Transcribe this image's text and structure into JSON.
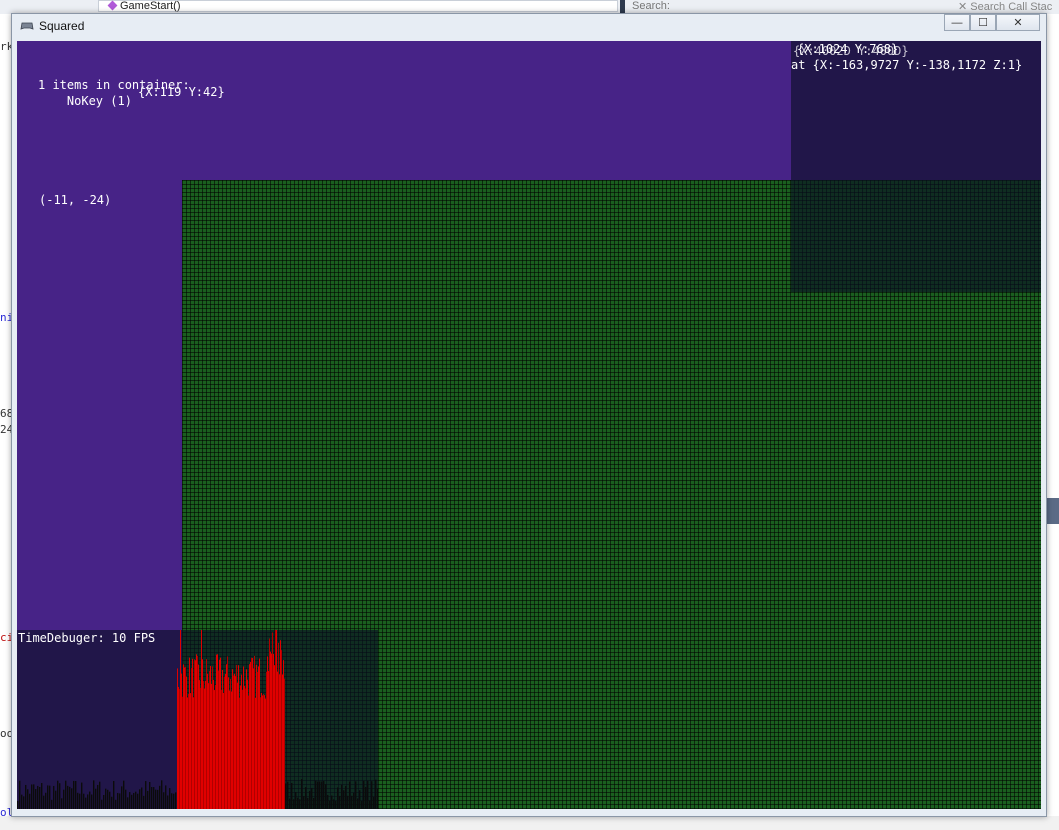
{
  "ide": {
    "dropdown_text": "GameStart()",
    "search_label": "Search:",
    "call_stack_search": "Search Call Stac",
    "left_fragments": [
      "rk",
      "ni",
      "68",
      "24",
      "oo",
      "ci",
      "ol"
    ]
  },
  "window": {
    "title": "Squared",
    "minimize_glyph": "—",
    "maximize_glyph": "☐",
    "close_glyph": "✕"
  },
  "game": {
    "container_info": "1 items in container:\n    NoKey (1)",
    "mouse_coords": "{X:119 Y:42}",
    "tile_coords": "(-11, -24)",
    "camera_line1": "{X:1024 Y:768}",
    "camera_line1_overlap": "{X:4002D Y:400D}",
    "camera_line2": "at {X:-163,9727 Y:-138,1172 Z:1}",
    "time_debugger": "TimeDebuger: 10 FPS"
  },
  "colors": {
    "background": "#472387",
    "grid": "#1a5f1f",
    "graph_red": "#e00000",
    "overlay": "#12142c"
  }
}
